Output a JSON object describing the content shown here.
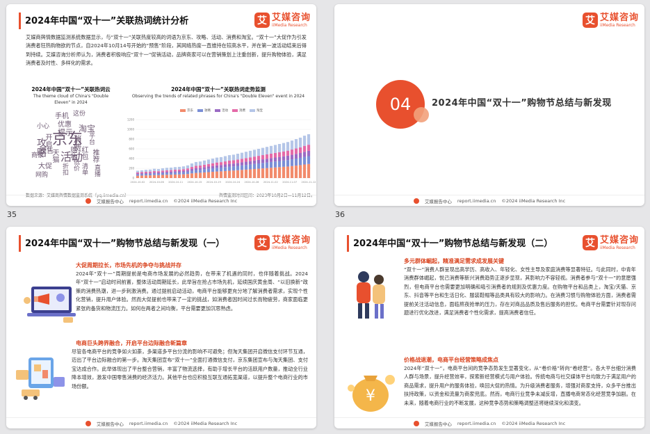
{
  "page_numbers": [
    "35",
    "36"
  ],
  "footer": {
    "label": "艾媒报告中心",
    "url": "report.iimedia.cn",
    "copyright": "©2024  iiMedia Research  Inc"
  },
  "logo": {
    "mark": "艾",
    "cn": "艾媒咨询",
    "en": "iiMedia Research"
  },
  "slide35": {
    "title": "2024年中国“双十一”关联热词统计分析",
    "intro": "艾媒商舆情数据监测系统数据显示，与“双十一”关联热度较高的词语为京东、攻略、活动、消费和淘宝。“双十一”大促作为引发消费者狂热购物欲的节点，自2024年10月14号开始的“预售”阶段，其网络热度一直维持在较高水平，并在第一波活动结束后得到持续。艾媒咨询分析师认为，消费者积极响应“双十一”促销活动，品牌商家可以在营销策划上注重创新，提升购物体验，满足消费者及时性、多样化的需求。",
    "cloud_title": "2024年中国“双十一”关联热词云",
    "cloud_subtitle": "The theme cloud of China's \"Double Eleven\" in 2024",
    "cloud_words": [
      "京东",
      "攻略",
      "活动",
      "消费",
      "淘宝",
      "手机",
      "优惠",
      "这份",
      "小心",
      "提示",
      "预售",
      "开启",
      "商家",
      "大促",
      "网购",
      "平台",
      "红包",
      "推荐",
      "购物",
      "天猫",
      "折扣",
      "低价",
      "清单",
      "直播"
    ],
    "trend_title": "2024年中国“双十一”关联热词走势监测",
    "trend_subtitle": "Observing the trends of related phrases for China's \"Double Eleven\" event in 2024",
    "source": "数据来源：艾媒商舆情数据监测系统（yq.iimedia.cn）",
    "period": "舆情监测时间区间：2023年10月2日—11月12日。",
    "colors": {
      "accent": "#e8502e"
    }
  },
  "chart_data": {
    "type": "bar",
    "title": "2024年中国“双十一”关联热词走势监测",
    "series": [
      {
        "name": "京东",
        "color": "#f28b6c"
      },
      {
        "name": "攻略",
        "color": "#7b8fd6"
      },
      {
        "name": "活动",
        "color": "#9b6bc4"
      },
      {
        "name": "消费",
        "color": "#e46aa8"
      },
      {
        "name": "淘宝",
        "color": "#b5c6e8"
      }
    ],
    "x_ticks": [
      "2024-10-02",
      "2024-10-06",
      "2024-10-11",
      "2024-10-15",
      "2024-10-19",
      "2024-10-24",
      "2024-10-28",
      "2024-11-02",
      "2024-11-07",
      "2024-11-12"
    ],
    "y_ticks": [
      "0",
      "200",
      "400",
      "600",
      "800",
      "1000",
      "1200"
    ],
    "ylim": [
      0,
      1200
    ],
    "daily_total": [
      150,
      160,
      170,
      175,
      190,
      185,
      200,
      210,
      215,
      225,
      230,
      240,
      260,
      300,
      330,
      340,
      360,
      380,
      400,
      420,
      430,
      450,
      470,
      480,
      500,
      520,
      540,
      560,
      580,
      600,
      620,
      640,
      660,
      680,
      700,
      720,
      740,
      770,
      800,
      830,
      870,
      900
    ],
    "grid": true,
    "legend_position": "top"
  },
  "slide36": {
    "number": "04",
    "title": "2024年中国“双十一”购物节总结与新发现"
  },
  "slide37": {
    "title": "2024年中国“双十一”购物节总结与新发现（一）",
    "h1": "大促周期拉长，市场先机的争夺与挑战并存",
    "p1": "2024年“双十一”周期提前是电商市场发展的必然趋势，在带来了机遇的同时，也伴随着挑战。2024年“双十一”启动时间前置，整体活动周期延长，此举旨在抢占市场先机，延续国庆黄金周、“以旧换新”政策的消费热潮，进一步刺激消费。通过提前启动活动，电商平台能够更充分地了解消费者需求，实现个性化营销，提升用户体验。然而大促提前也带来了一定的挑战，如消费者因时间过长而物疲劳，商家面临更紧张的备货和物流压力。如何在两者之间均衡，平台需要更加沉思熟虑。",
    "h2": "电商巨头跨界融合，开启平台边际融合新篇章",
    "p2": "尽管各电商平台的竞争如火如荼，多渠道多平台分流的影响不可避免；但淘天集团开启微信支付环节互通，迈出了平台边际融合的第一步。淘天集团宣布“双十一”全面打通微信支付，京东集团宣布与淘天集团、支付宝达成合作。此举体现出了平台整合营销，丰富了物流选择，有助于增长平台的活跃用户数量，推动全行业降本增效，激发中国零售消费的经济活力。其他平台也应积极互联互通拓宽渠道，以提升整个电商行业的市场份额。"
  },
  "slide38": {
    "title": "2024年中国“双十一”购物节总结与新发现（二）",
    "h1": "多元群体崛起，精准满足需求成发展关键",
    "p1": "“双十一”消费人群呈现出高学历、高收入、年轻化、女性主导及家庭消费等显著特征。与此同时，中青年消费群体崛起，悦己消费等新兴消费趋势正逐步显现，其影响力不容轻视。消费者参与“双十一”的意愿强烈，但电商平台也需要更加明确和吸引消费者的规则及优惠力度。在购物平台和品类上，淘宝/天猫、京东、抖音等平台和生活日化、服装鞋帽等品类具有较大的影响力。在消费习惯与购物体验方面，消费者需提前关注活动信息，面临熬夜抢单的压力，存在对商品品质及售后服务的担忧。电商平台需要针对现存问题进行优化改进，满足消费者个性化需求，提高消费者信任。",
    "h2": "价格战退潮，电商平台经营策略成焦点",
    "p2": "2024年“双十一”，电商平台间的竞争态势发生显著变化，从“卷价格”转向“卷经营”。各大平台细分消费人群与场景，提升经营效率，探索新经营模式与用户体验。传统电商与社交媒体平台均致力于满足用户的商品需求，提升用户的服务体验，唤回大促的热情。为升级消费者服务，增强对商家支持，众多平台推出扶持政策，以资金和流量为商家兜底。然而，电商行业竞争未减反增，直播电商常态化经营竞争加剧。在未来，随着电商行业的不断发展，这种竞争态势和策略调整还将继续深化和演变。"
  }
}
